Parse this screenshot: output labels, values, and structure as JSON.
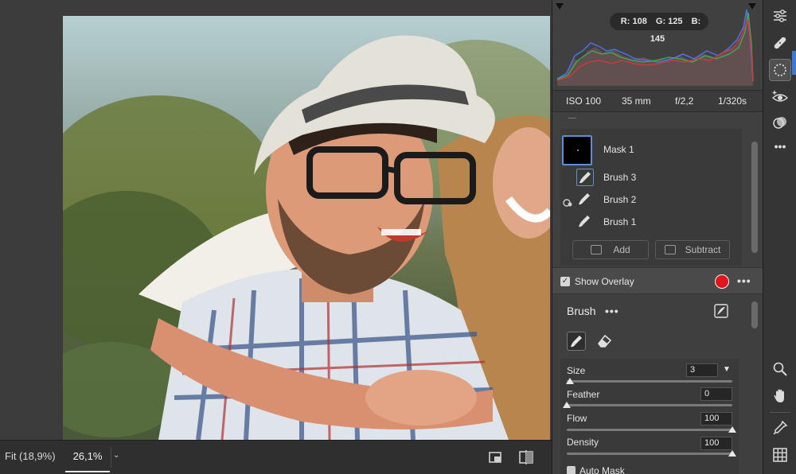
{
  "histogram": {
    "rgb_readout": {
      "r_label": "R: 108",
      "g_label": "G: 125",
      "b_label": "B: 145"
    }
  },
  "exif": {
    "iso": "ISO 100",
    "focal_length": "35 mm",
    "aperture": "f/2,2",
    "shutter": "1/320s"
  },
  "masks": {
    "mask_label": "Mask 1",
    "brushes": [
      {
        "label": "Brush 3"
      },
      {
        "label": "Brush 2"
      },
      {
        "label": "Brush 1"
      }
    ],
    "add_label": "Add",
    "subtract_label": "Subtract"
  },
  "overlay": {
    "label": "Show Overlay",
    "checked": true,
    "color": "#e0161e"
  },
  "brush": {
    "title": "Brush",
    "sliders": [
      {
        "label": "Size",
        "value": "3",
        "level": 0.02
      },
      {
        "label": "Feather",
        "value": "0",
        "level": 0.0
      },
      {
        "label": "Flow",
        "value": "100",
        "level": 1.0
      },
      {
        "label": "Density",
        "value": "100",
        "level": 1.0
      }
    ],
    "auto_mask_label": "Auto Mask"
  },
  "bottom_bar": {
    "zoom_fit": "Fit (18,9%)",
    "zoom_custom": "26,1%"
  },
  "tools": [
    "sliders-icon",
    "healing-icon",
    "masking-icon",
    "redeye-icon",
    "presets-icon",
    "more-icon",
    "zoom-icon",
    "hand-icon",
    "eyedropper-icon",
    "grid-icon"
  ],
  "colors": {
    "accent": "#5e8ed6",
    "overlay": "#e0161e"
  }
}
